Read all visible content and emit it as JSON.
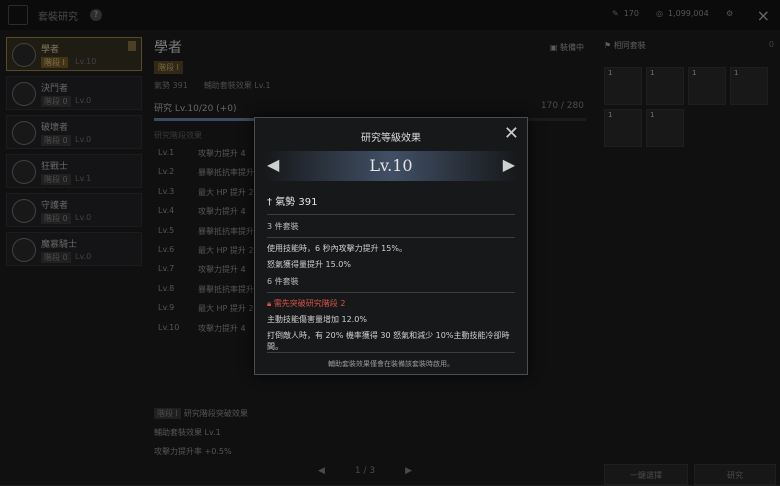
{
  "topbar": {
    "title": "套裝研究",
    "help": "?",
    "res1": "170",
    "res2": "1,099,004"
  },
  "sidebar": {
    "items": [
      {
        "name": "學者",
        "stage": "階段 I",
        "level": "Lv.10",
        "active": true
      },
      {
        "name": "決鬥者",
        "stage": "階段 0",
        "level": "Lv.0"
      },
      {
        "name": "破壞者",
        "stage": "階段 0",
        "level": "Lv.0"
      },
      {
        "name": "狂戰士",
        "stage": "階段 0",
        "level": "Lv.1"
      },
      {
        "name": "守護者",
        "stage": "階段 0",
        "level": "Lv.0"
      },
      {
        "name": "魔慕騎士",
        "stage": "階段 0",
        "level": "Lv.0"
      }
    ]
  },
  "main": {
    "title": "學者",
    "stage": "階段 I",
    "equipped": "裝備中",
    "momentum": "氣勢 391",
    "aux": "輔助套裝效果 Lv.1",
    "research": "研究 Lv.10/20 (+0)",
    "progress": "170 / 280",
    "progress_fraction": 0.607,
    "section": "研究階段效果",
    "rows": [
      {
        "lv": "Lv.1",
        "txt": "攻擊力提升 4"
      },
      {
        "lv": "Lv.2",
        "txt": "暴擊抵抗率提升"
      },
      {
        "lv": "Lv.3",
        "txt": "最大 HP 提升 20"
      },
      {
        "lv": "Lv.4",
        "txt": "攻擊力提升 4"
      },
      {
        "lv": "Lv.5",
        "txt": "暴擊抵抗率提升"
      },
      {
        "lv": "Lv.6",
        "txt": "最大 HP 提升 20"
      },
      {
        "lv": "Lv.7",
        "txt": "攻擊力提升 4"
      },
      {
        "lv": "Lv.8",
        "txt": "暴擊抵抗率提升"
      },
      {
        "lv": "Lv.9",
        "txt": "最大 HP 提升 20"
      },
      {
        "lv": "Lv.10",
        "txt": "攻擊力提升 4"
      }
    ]
  },
  "bottom": {
    "tag": "階段 I",
    "text1": "研究階段突破效果",
    "text2": "輔助套裝效果 Lv.1",
    "text3": "攻擊力提升率 +0.5%"
  },
  "pager": {
    "label": "1 / 3"
  },
  "right": {
    "title": "相同套裝",
    "count": "0",
    "slots": [
      "1",
      "1",
      "1",
      "1",
      "1",
      "1"
    ],
    "btn1": "一鍵選擇",
    "btn2": "研究"
  },
  "modal": {
    "title": "研究等級效果",
    "level": "Lv.10",
    "momentum": "氣勢 391",
    "set3": "3 件套裝",
    "set3_l1": "使用技能時，6 秒內攻擊力提升 15%。",
    "set3_l2": "怒氣獲得量提升 15.0%",
    "set6": "6 件套裝",
    "warn": "需先突破研究階段 2",
    "set6_l1": "主動技能傷害量增加 12.0%",
    "set6_l2": "打倒敵人時，有 20% 機率獲得 30 怒氣和減少 10%主動技能冷卻時間。",
    "footer": "輔助套裝效果僅會在裝備該套裝時啟用。"
  }
}
